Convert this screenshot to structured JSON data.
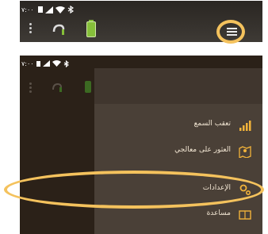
{
  "top_bar": {
    "status": {
      "time": "٧:٠٠"
    }
  },
  "drawer_screen": {
    "status": {
      "time": "٧:٠٠"
    },
    "menu": [
      {
        "label": "تعقب السمع"
      },
      {
        "label": "العثور على معالجي"
      },
      {
        "label": "الإعدادات"
      },
      {
        "label": "مساعدة"
      }
    ]
  },
  "colors": {
    "highlight_ring": "#f4c25d",
    "accent_icon": "#f2b33a",
    "battery_green": "#86bf3a",
    "drawer_bg": "#4a4037"
  }
}
